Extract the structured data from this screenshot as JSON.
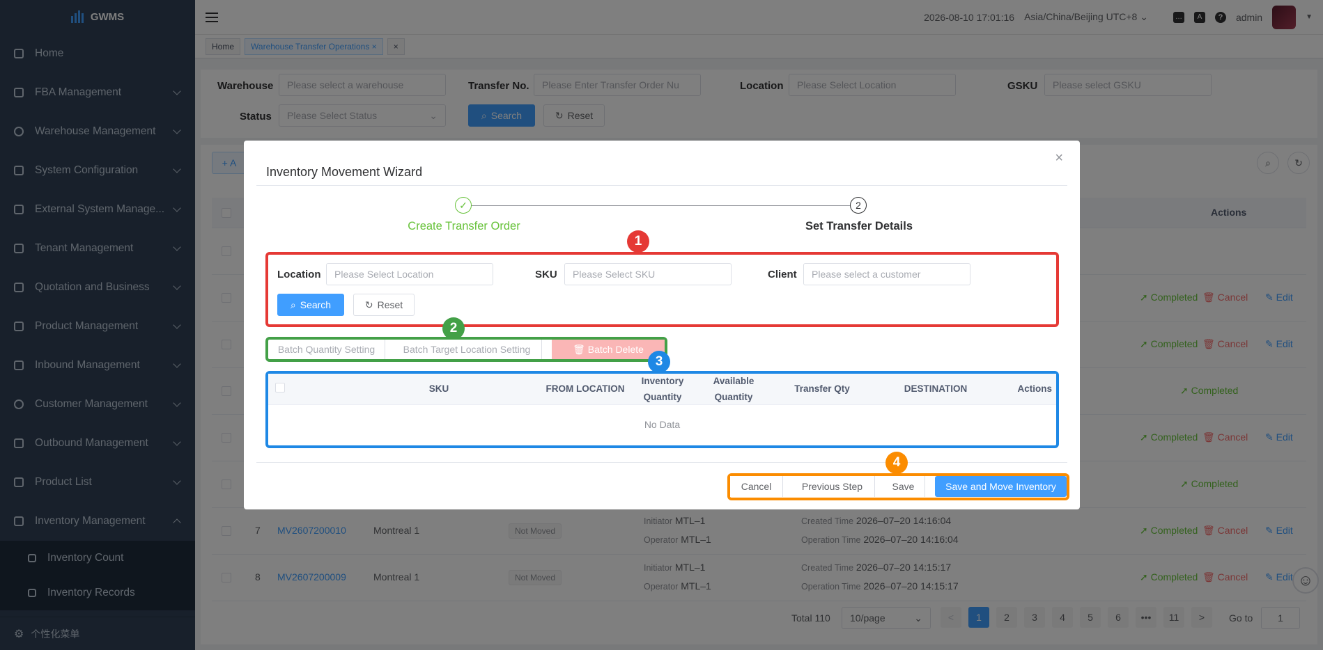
{
  "app": {
    "name": "GWMS"
  },
  "sidebar": {
    "items": [
      {
        "label": "Home"
      },
      {
        "label": "FBA Management"
      },
      {
        "label": "Warehouse Management"
      },
      {
        "label": "System Configuration"
      },
      {
        "label": "External System Manage..."
      },
      {
        "label": "Tenant Management"
      },
      {
        "label": "Quotation and Business"
      },
      {
        "label": "Product Management"
      },
      {
        "label": "Inbound Management"
      },
      {
        "label": "Customer Management"
      },
      {
        "label": "Outbound Management"
      },
      {
        "label": "Product List"
      },
      {
        "label": "Inventory Management"
      }
    ],
    "subitems": [
      {
        "label": "Inventory Count"
      },
      {
        "label": "Inventory Records"
      }
    ],
    "bottom_label": "个性化菜单"
  },
  "navbar": {
    "datetime": "2026-08-10 17:01:16",
    "timezone": "Asia/China/Beijing UTC+8",
    "user": "admin"
  },
  "tags": {
    "home": "Home",
    "current": "Warehouse Transfer Operations",
    "close": "×",
    "close_all": "×"
  },
  "filters": {
    "warehouse_label": "Warehouse",
    "warehouse_placeholder": "Please select a warehouse",
    "transfer_label": "Transfer No.",
    "transfer_placeholder": "Please Enter Transfer Order Nu",
    "location_label": "Location",
    "location_placeholder": "Please Select Location",
    "gsku_label": "GSKU",
    "gsku_placeholder": "Please select GSKU",
    "status_label": "Status",
    "status_placeholder": "Please Select Status",
    "search": "Search",
    "reset": "Reset"
  },
  "table": {
    "add_label": "+ A",
    "actions_header": "Actions",
    "row_actions": {
      "completed": "Completed",
      "cancel": "Cancel",
      "edit": "Edit"
    },
    "rows": [
      {
        "idx": "7",
        "no": "MV2607200010",
        "warehouse": "Montreal 1",
        "status": "Not Moved",
        "initiator_label": "Initiator",
        "initiator": "MTL–1",
        "operator_label": "Operator",
        "operator": "MTL–1",
        "created_label": "Created Time",
        "created": "2026–07–20 14:16:04",
        "op_time_label": "Operation Time",
        "op_time": "2026–07–20 14:16:04"
      },
      {
        "idx": "8",
        "no": "MV2607200009",
        "warehouse": "Montreal 1",
        "status": "Not Moved",
        "initiator_label": "Initiator",
        "initiator": "MTL–1",
        "operator_label": "Operator",
        "operator": "MTL–1",
        "created_label": "Created Time",
        "created": "2026–07–20 14:15:17",
        "op_time_label": "Operation Time",
        "op_time": "2026–07–20 14:15:17"
      }
    ]
  },
  "pagination": {
    "total": "Total 110",
    "page_size": "10/page",
    "pages": [
      "1",
      "2",
      "3",
      "4",
      "5",
      "6",
      "•••",
      "11"
    ],
    "prev": "<",
    "next": ">",
    "goto_label": "Go to",
    "goto_value": "1"
  },
  "dialog": {
    "title": "Inventory Movement Wizard",
    "close": "×",
    "steps": [
      {
        "number": "✓",
        "title": "Create Transfer Order"
      },
      {
        "number": "2",
        "title": "Set Transfer Details"
      }
    ],
    "search": {
      "location_label": "Location",
      "location_placeholder": "Please Select Location",
      "sku_label": "SKU",
      "sku_placeholder": "Please Select SKU",
      "client_label": "Client",
      "client_placeholder": "Please select a customer",
      "search": "Search",
      "reset": "Reset"
    },
    "batch": {
      "qty": "Batch Quantity Setting",
      "target": "Batch Target Location Setting",
      "delete": "Batch Delete"
    },
    "table": {
      "headers": {
        "sku": "SKU",
        "from": "FROM LOCATION",
        "inv_qty": "Inventory Quantity",
        "avail_qty": "Available Quantity",
        "transfer_qty": "Transfer Qty",
        "destination": "DESTINATION",
        "actions": "Actions"
      },
      "empty": "No Data"
    },
    "footer": {
      "cancel": "Cancel",
      "previous": "Previous Step",
      "save": "Save",
      "save_move": "Save and Move Inventory"
    },
    "annotations": [
      "1",
      "2",
      "3",
      "4"
    ]
  },
  "colors": {
    "sidebar_bg": "#304156",
    "primary": "#409eff",
    "success": "#67c23a",
    "danger": "#f56c6c",
    "annotation_red": "#e53935",
    "annotation_green": "#43a047",
    "annotation_blue": "#1e88e5",
    "annotation_orange": "#fb8c00"
  }
}
